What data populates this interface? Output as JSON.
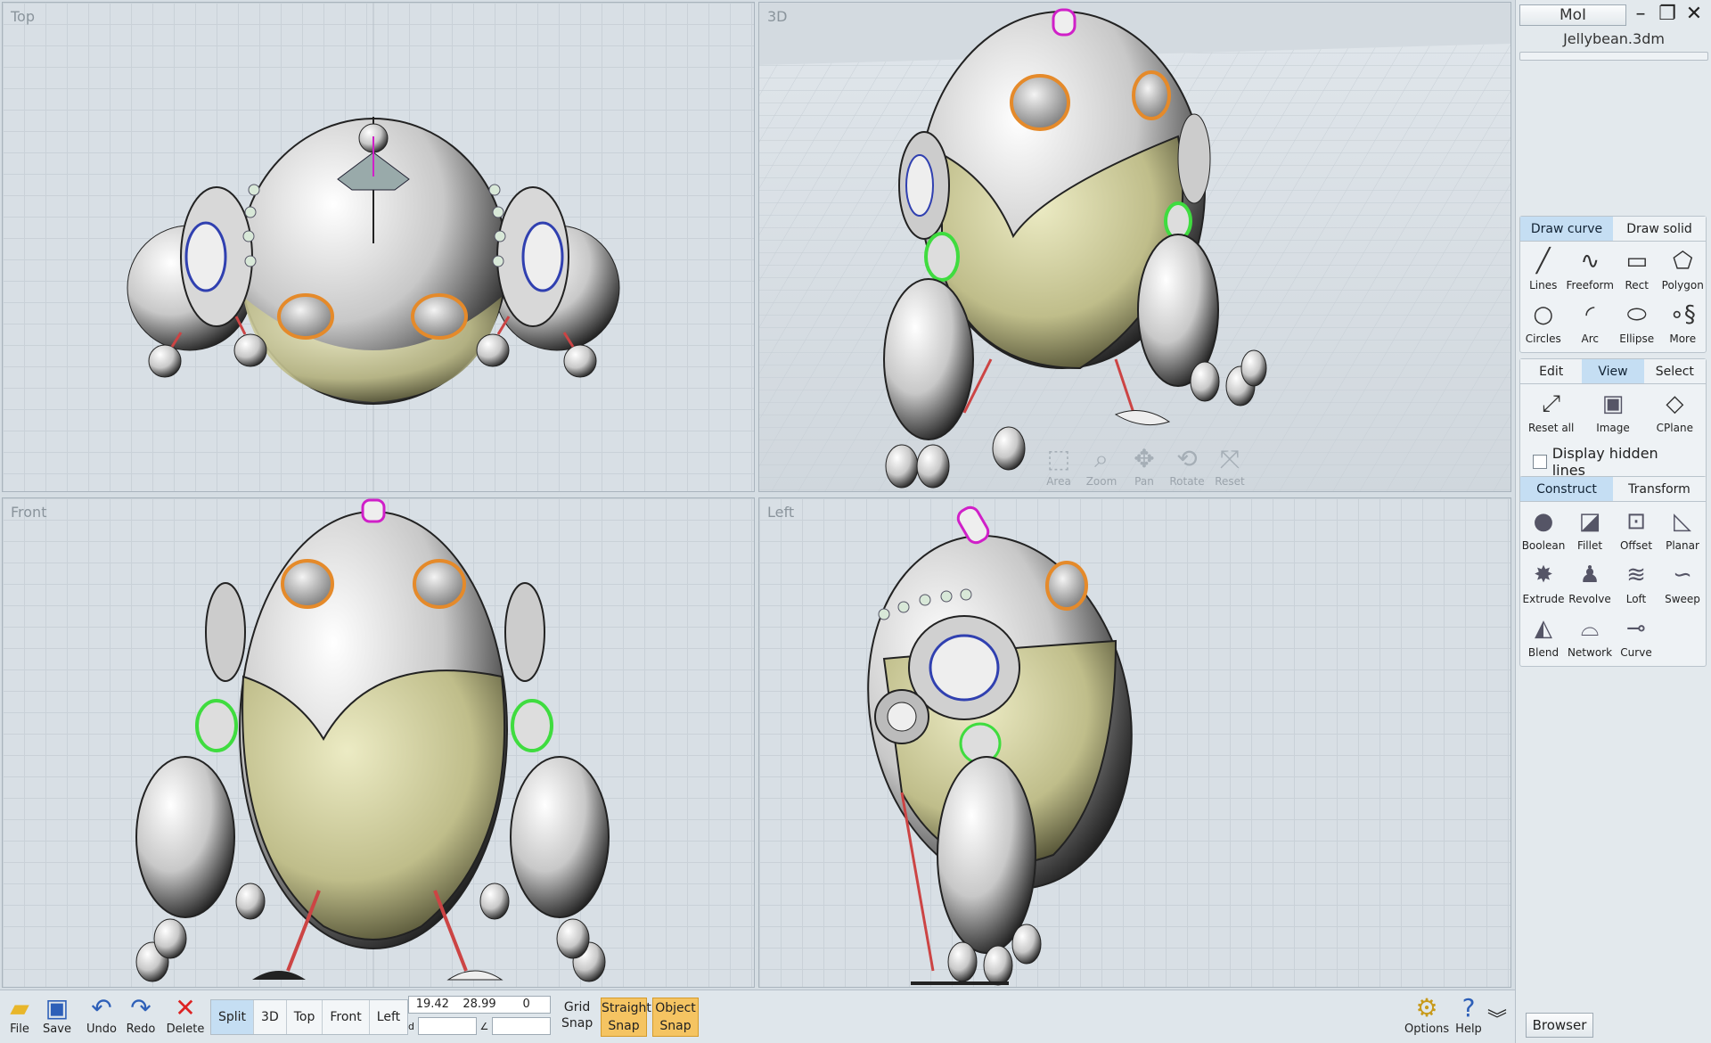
{
  "viewports": {
    "top": "Top",
    "threed": "3D",
    "front": "Front",
    "left": "Left"
  },
  "nav3d": [
    {
      "label": "Area",
      "icon": "area-zoom-icon"
    },
    {
      "label": "Zoom",
      "icon": "zoom-icon"
    },
    {
      "label": "Pan",
      "icon": "pan-icon"
    },
    {
      "label": "Rotate",
      "icon": "rotate-icon"
    },
    {
      "label": "Reset",
      "icon": "reset-icon"
    }
  ],
  "panel": {
    "app_button": "MoI",
    "filename": "Jellybean.3dm",
    "draw_tabs": [
      "Draw curve",
      "Draw solid"
    ],
    "draw_tools": [
      "Lines",
      "Freeform",
      "Rect",
      "Polygon",
      "Circles",
      "Arc",
      "Ellipse",
      "More"
    ],
    "edit_tabs": [
      "Edit",
      "View",
      "Select"
    ],
    "view_tools": [
      "Reset all",
      "Image",
      "CPlane"
    ],
    "display_hidden_lines": "Display hidden lines",
    "construct_tabs": [
      "Construct",
      "Transform"
    ],
    "construct_tools": [
      "Boolean",
      "Fillet",
      "Offset",
      "Planar",
      "Extrude",
      "Revolve",
      "Loft",
      "Sweep",
      "Blend",
      "Network",
      "Curve"
    ]
  },
  "toolbar": {
    "file": "File",
    "save": "Save",
    "undo": "Undo",
    "redo": "Redo",
    "delete": "Delete",
    "view_tabs": [
      "Split",
      "3D",
      "Top",
      "Front",
      "Left"
    ],
    "coord_x": "19.42",
    "coord_y": "28.99",
    "coord_z": "0",
    "dist_label": "d",
    "angle_label": "∠",
    "grid_snap": [
      "Grid",
      "Snap"
    ],
    "straight_snap": [
      "Straight",
      "Snap"
    ],
    "object_snap": [
      "Object",
      "Snap"
    ],
    "options": "Options",
    "help": "Help",
    "browser": "Browser"
  },
  "colors": {
    "active_tab": "#c5def3",
    "snap_on": "#f5c462",
    "body_white": "#e8e8e8",
    "body_olive": "#cfcf9e",
    "rim_orange": "#e58a2a",
    "accent_green": "#3fdc3f",
    "antenna_magenta": "#d020c8"
  }
}
